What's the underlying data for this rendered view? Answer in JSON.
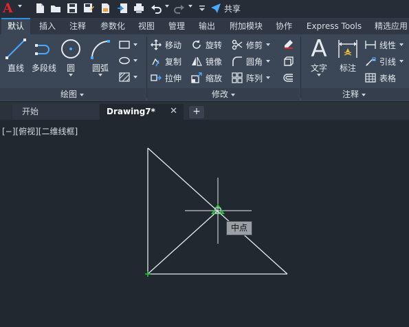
{
  "app": {
    "logo": "A"
  },
  "quick_access": {
    "share_label": "共享"
  },
  "tabs": [
    "默认",
    "插入",
    "注释",
    "参数化",
    "视图",
    "管理",
    "输出",
    "附加模块",
    "协作",
    "Express Tools",
    "精选应用"
  ],
  "ribbon": {
    "draw": {
      "title": "绘图",
      "line": "直线",
      "polyline": "多段线",
      "circle": "圆",
      "arc": "圆弧"
    },
    "modify": {
      "title": "修改",
      "move": "移动",
      "rotate": "旋转",
      "trim": "修剪",
      "copy": "复制",
      "mirror": "镜像",
      "fillet": "圆角",
      "stretch": "拉伸",
      "scale": "缩放",
      "array": "阵列"
    },
    "annotation": {
      "title": "注释",
      "text": "文字",
      "dimension": "标注",
      "linear": "线性",
      "leader": "引线",
      "table": "表格"
    }
  },
  "file_tabs": {
    "start": "开始",
    "drawing": "Drawing7*",
    "close": "✕",
    "new": "+"
  },
  "viewport": {
    "label": "[−][俯视][二维线框]",
    "snap_tooltip": "中点"
  },
  "colors": {
    "accent": "#2f90e0",
    "logo_red": "#e0252c",
    "snap_green": "#1fc23a",
    "background": "#212830"
  }
}
